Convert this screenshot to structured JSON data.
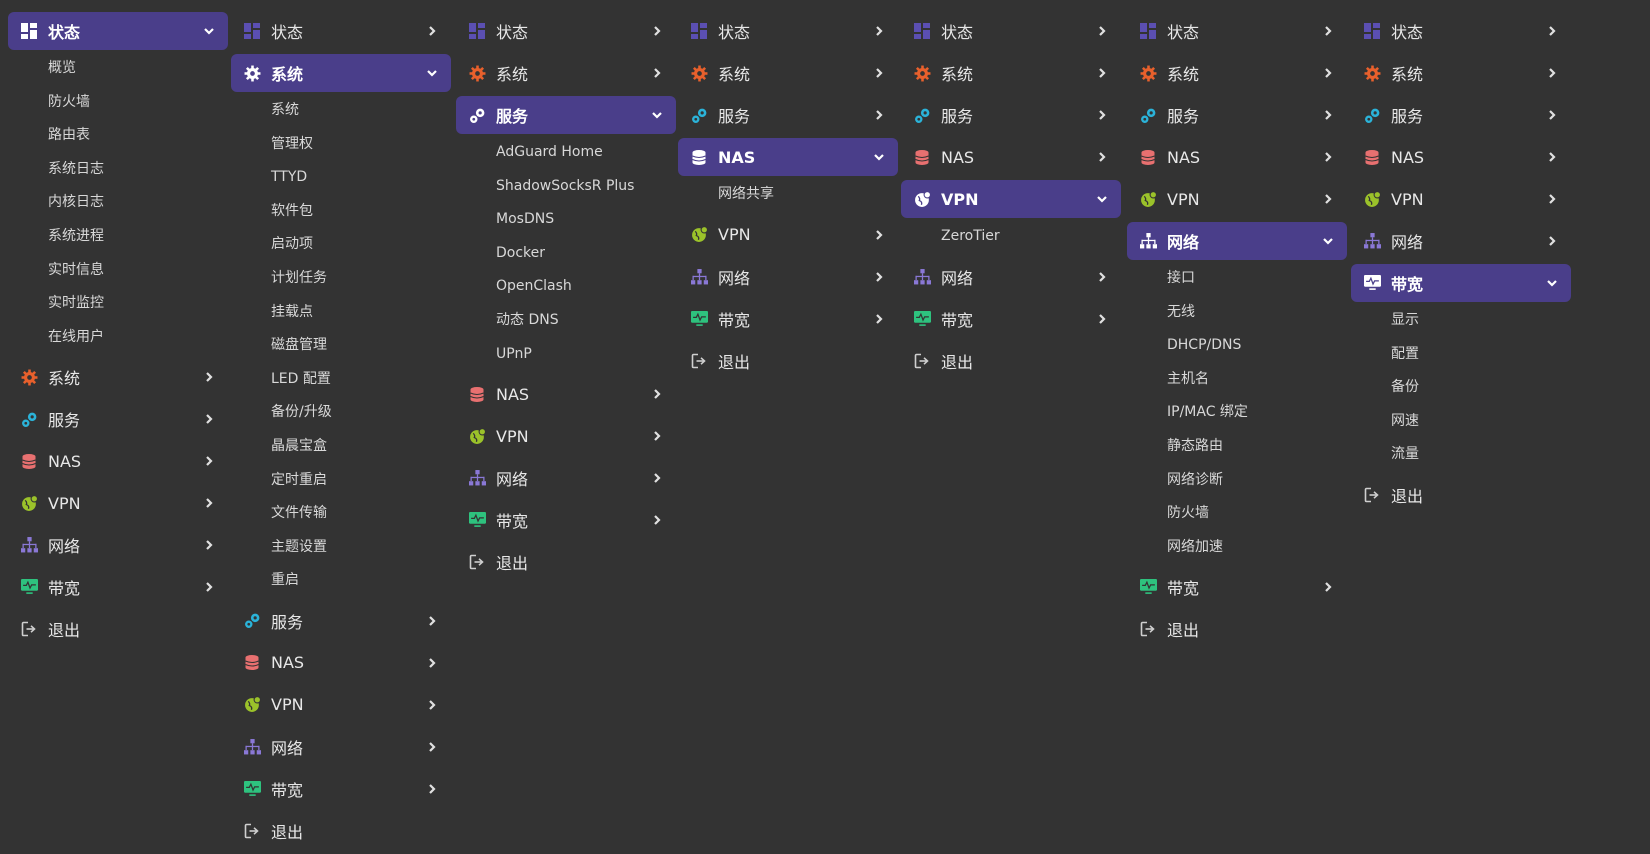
{
  "colors": {
    "background": "#333333",
    "active_bg": "#4a3e8a",
    "status_icon": "#5b4fb2",
    "system_icon": "#e8602c",
    "services_icon": "#2bb3d9",
    "nas_icon": "#e87070",
    "vpn_icon": "#9bc22a",
    "network_icon": "#8a78d6",
    "bandwidth_icon": "#2ec27e"
  },
  "menus": [
    {
      "active": "status",
      "items": [
        {
          "key": "status",
          "label": "状态",
          "icon": "status-icon"
        },
        {
          "key": "system",
          "label": "系统",
          "icon": "gear-icon"
        },
        {
          "key": "services",
          "label": "服务",
          "icon": "services-icon"
        },
        {
          "key": "nas",
          "label": "NAS",
          "icon": "database-icon"
        },
        {
          "key": "vpn",
          "label": "VPN",
          "icon": "globe-icon"
        },
        {
          "key": "network",
          "label": "网络",
          "icon": "network-icon"
        },
        {
          "key": "bandwidth",
          "label": "带宽",
          "icon": "monitor-icon"
        },
        {
          "key": "logout",
          "label": "退出",
          "icon": "logout-icon"
        }
      ],
      "sub": [
        "概览",
        "防火墙",
        "路由表",
        "系统日志",
        "内核日志",
        "系统进程",
        "实时信息",
        "实时监控",
        "在线用户"
      ]
    },
    {
      "active": "system",
      "items": [
        {
          "key": "status",
          "label": "状态",
          "icon": "status-icon"
        },
        {
          "key": "system",
          "label": "系统",
          "icon": "gear-icon"
        },
        {
          "key": "services",
          "label": "服务",
          "icon": "services-icon"
        },
        {
          "key": "nas",
          "label": "NAS",
          "icon": "database-icon"
        },
        {
          "key": "vpn",
          "label": "VPN",
          "icon": "globe-icon"
        },
        {
          "key": "network",
          "label": "网络",
          "icon": "network-icon"
        },
        {
          "key": "bandwidth",
          "label": "带宽",
          "icon": "monitor-icon"
        },
        {
          "key": "logout",
          "label": "退出",
          "icon": "logout-icon"
        }
      ],
      "sub": [
        "系统",
        "管理权",
        "TTYD",
        "软件包",
        "启动项",
        "计划任务",
        "挂载点",
        "磁盘管理",
        "LED 配置",
        "备份/升级",
        "晶晨宝盒",
        "定时重启",
        "文件传输",
        "主题设置",
        "重启"
      ]
    },
    {
      "active": "services",
      "items": [
        {
          "key": "status",
          "label": "状态",
          "icon": "status-icon"
        },
        {
          "key": "system",
          "label": "系统",
          "icon": "gear-icon"
        },
        {
          "key": "services",
          "label": "服务",
          "icon": "services-icon"
        },
        {
          "key": "nas",
          "label": "NAS",
          "icon": "database-icon"
        },
        {
          "key": "vpn",
          "label": "VPN",
          "icon": "globe-icon"
        },
        {
          "key": "network",
          "label": "网络",
          "icon": "network-icon"
        },
        {
          "key": "bandwidth",
          "label": "带宽",
          "icon": "monitor-icon"
        },
        {
          "key": "logout",
          "label": "退出",
          "icon": "logout-icon"
        }
      ],
      "sub": [
        "AdGuard Home",
        "ShadowSocksR Plus",
        "MosDNS",
        "Docker",
        "OpenClash",
        "动态 DNS",
        "UPnP"
      ]
    },
    {
      "active": "nas",
      "items": [
        {
          "key": "status",
          "label": "状态",
          "icon": "status-icon"
        },
        {
          "key": "system",
          "label": "系统",
          "icon": "gear-icon"
        },
        {
          "key": "services",
          "label": "服务",
          "icon": "services-icon"
        },
        {
          "key": "nas",
          "label": "NAS",
          "icon": "database-icon"
        },
        {
          "key": "vpn",
          "label": "VPN",
          "icon": "globe-icon"
        },
        {
          "key": "network",
          "label": "网络",
          "icon": "network-icon"
        },
        {
          "key": "bandwidth",
          "label": "带宽",
          "icon": "monitor-icon"
        },
        {
          "key": "logout",
          "label": "退出",
          "icon": "logout-icon"
        }
      ],
      "sub": [
        "网络共享"
      ]
    },
    {
      "active": "vpn",
      "items": [
        {
          "key": "status",
          "label": "状态",
          "icon": "status-icon"
        },
        {
          "key": "system",
          "label": "系统",
          "icon": "gear-icon"
        },
        {
          "key": "services",
          "label": "服务",
          "icon": "services-icon"
        },
        {
          "key": "nas",
          "label": "NAS",
          "icon": "database-icon"
        },
        {
          "key": "vpn",
          "label": "VPN",
          "icon": "globe-icon"
        },
        {
          "key": "network",
          "label": "网络",
          "icon": "network-icon"
        },
        {
          "key": "bandwidth",
          "label": "带宽",
          "icon": "monitor-icon"
        },
        {
          "key": "logout",
          "label": "退出",
          "icon": "logout-icon"
        }
      ],
      "sub": [
        "ZeroTier"
      ]
    },
    {
      "active": "network",
      "items": [
        {
          "key": "status",
          "label": "状态",
          "icon": "status-icon"
        },
        {
          "key": "system",
          "label": "系统",
          "icon": "gear-icon"
        },
        {
          "key": "services",
          "label": "服务",
          "icon": "services-icon"
        },
        {
          "key": "nas",
          "label": "NAS",
          "icon": "database-icon"
        },
        {
          "key": "vpn",
          "label": "VPN",
          "icon": "globe-icon"
        },
        {
          "key": "network",
          "label": "网络",
          "icon": "network-icon"
        },
        {
          "key": "bandwidth",
          "label": "带宽",
          "icon": "monitor-icon"
        },
        {
          "key": "logout",
          "label": "退出",
          "icon": "logout-icon"
        }
      ],
      "sub": [
        "接口",
        "无线",
        "DHCP/DNS",
        "主机名",
        "IP/MAC 绑定",
        "静态路由",
        "网络诊断",
        "防火墙",
        "网络加速"
      ]
    },
    {
      "active": "bandwidth",
      "items": [
        {
          "key": "status",
          "label": "状态",
          "icon": "status-icon"
        },
        {
          "key": "system",
          "label": "系统",
          "icon": "gear-icon"
        },
        {
          "key": "services",
          "label": "服务",
          "icon": "services-icon"
        },
        {
          "key": "nas",
          "label": "NAS",
          "icon": "database-icon"
        },
        {
          "key": "vpn",
          "label": "VPN",
          "icon": "globe-icon"
        },
        {
          "key": "network",
          "label": "网络",
          "icon": "network-icon"
        },
        {
          "key": "bandwidth",
          "label": "带宽",
          "icon": "monitor-icon"
        },
        {
          "key": "logout",
          "label": "退出",
          "icon": "logout-icon"
        }
      ],
      "sub": [
        "显示",
        "配置",
        "备份",
        "网速",
        "流量"
      ]
    }
  ]
}
